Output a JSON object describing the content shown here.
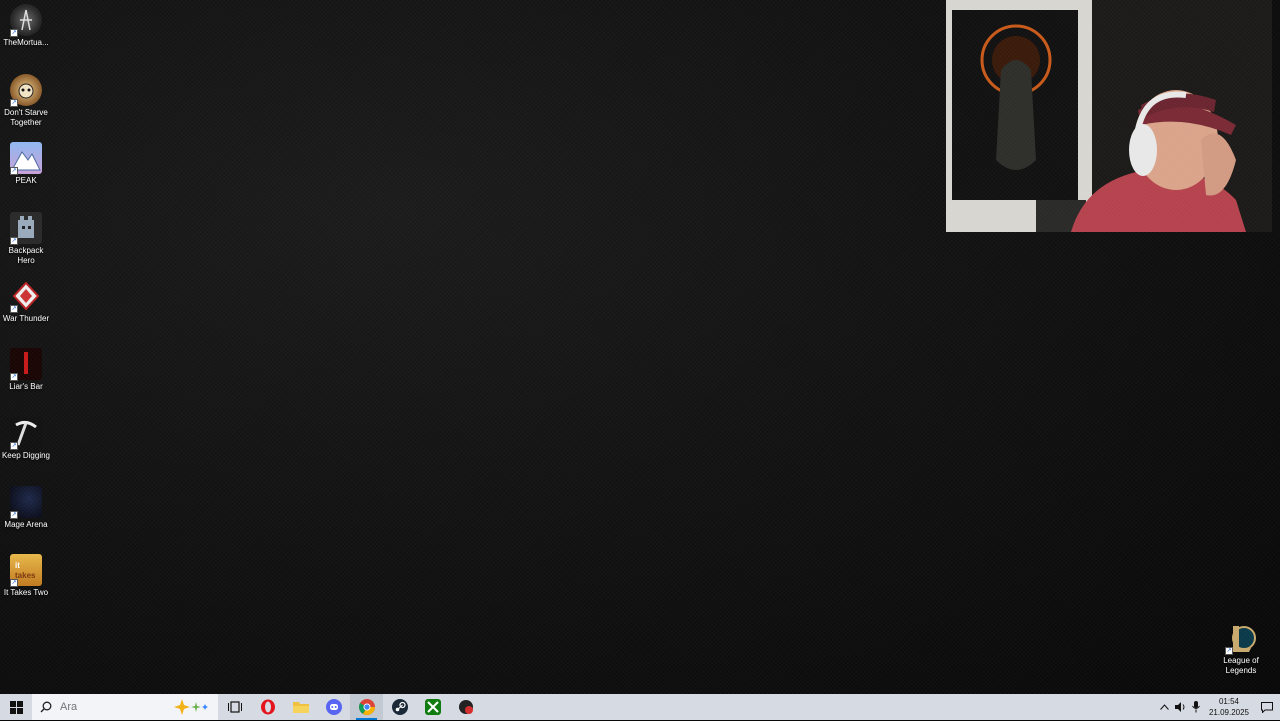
{
  "desktop": {
    "icons": [
      {
        "label": "TheMortua...",
        "icon": "the-mortuary-icon"
      },
      {
        "label": "Don't Starve Together",
        "icon": "dont-starve-icon"
      },
      {
        "label": "PEAK",
        "icon": "peak-icon"
      },
      {
        "label": "Backpack Hero",
        "icon": "backpack-hero-icon"
      },
      {
        "label": "War Thunder",
        "icon": "war-thunder-icon"
      },
      {
        "label": "Liar's Bar",
        "icon": "liars-bar-icon"
      },
      {
        "label": "Keep Digging",
        "icon": "keep-digging-icon"
      },
      {
        "label": "Mage Arena",
        "icon": "mage-arena-icon"
      },
      {
        "label": "It Takes Two",
        "icon": "it-takes-two-icon"
      }
    ],
    "right_icon": {
      "label": "League of Legends",
      "icon": "league-of-legends-icon"
    }
  },
  "webcam": {
    "description_icon": "webcam-overlay"
  },
  "taskbar": {
    "search_placeholder": "Ara",
    "apps": [
      "task-view-icon",
      "opera-icon",
      "file-explorer-icon",
      "discord-icon",
      "chrome-icon",
      "steam-icon",
      "xbox-icon",
      "game-app-icon"
    ],
    "clock_time": "01:54",
    "clock_date": "21.09.2025",
    "colors": {
      "taskbar": "#d6dbe3",
      "accent": "#0078d4"
    }
  }
}
